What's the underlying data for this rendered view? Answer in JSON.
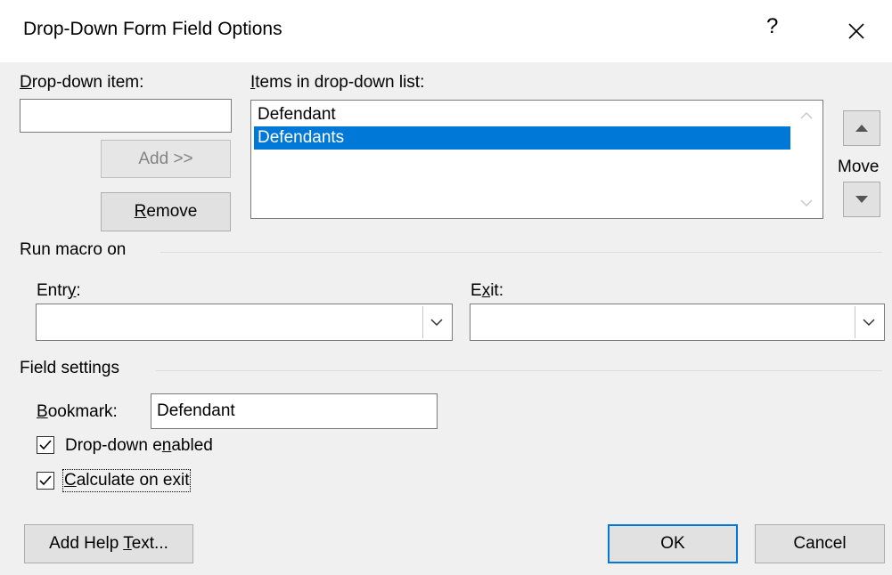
{
  "window": {
    "title": "Drop-Down Form Field Options",
    "help_label": "?"
  },
  "dropdown_item": {
    "label": "Drop-down item:",
    "value": ""
  },
  "items_list": {
    "label": "Items in drop-down list:",
    "items": [
      "Defendant",
      "Defendants"
    ],
    "selected_index": 1
  },
  "buttons": {
    "add": "Add >>",
    "remove": "Remove",
    "add_help_text": "Add Help Text...",
    "ok": "OK",
    "cancel": "Cancel"
  },
  "move": {
    "label": "Move"
  },
  "run_macro": {
    "group_label": "Run macro on",
    "entry_label": "Entry:",
    "entry_value": "",
    "exit_label": "Exit:",
    "exit_value": ""
  },
  "field_settings": {
    "group_label": "Field settings",
    "bookmark_label": "Bookmark:",
    "bookmark_value": "Defendant",
    "dropdown_enabled_label": "Drop-down enabled",
    "dropdown_enabled_checked": true,
    "calculate_on_exit_label": "Calculate on exit",
    "calculate_on_exit_checked": true
  },
  "colors": {
    "selection": "#0078d7",
    "default_button_border": "#0078d7"
  }
}
